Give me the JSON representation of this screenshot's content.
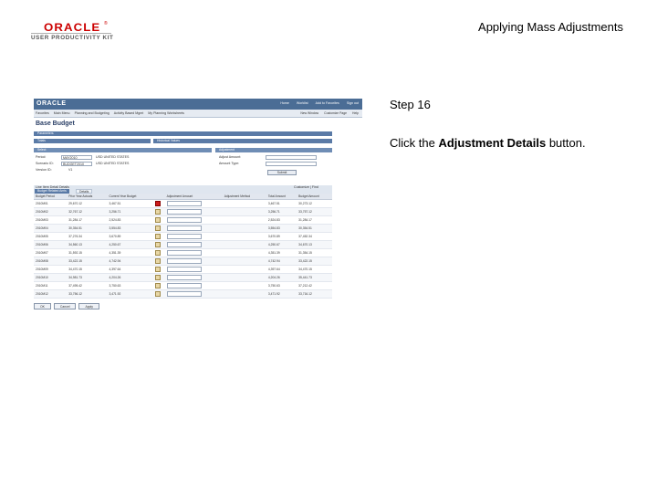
{
  "header": {
    "brand": "ORACLE",
    "brand_reg": "®",
    "product": "USER PRODUCTIVITY KIT",
    "title": "Applying Mass Adjustments"
  },
  "step": {
    "number_label": "Step 16",
    "instruction_prefix": "Click the ",
    "instruction_target": "Adjustment Details",
    "instruction_suffix": " button."
  },
  "screenshot": {
    "brand": "ORACLE",
    "top_links": [
      "Home",
      "Worklist",
      "Add to Favorites",
      "Sign out"
    ],
    "nav_items": [
      "Favorites",
      "Main Menu",
      "Planning and Budgeting",
      "Activity Based Mgmt",
      "My Planning Worksheets"
    ],
    "nav_right": [
      "New Window",
      "Customize Page",
      "Help"
    ],
    "page_title": "Base Budget",
    "sections": [
      "Parameters",
      "Totals",
      "Historical Values",
      "Select",
      "Adjustment"
    ],
    "fields": {
      "period": "Period:",
      "period_value": "MAY2010",
      "scenario": "Scenario ID:",
      "scenario_value": "BUDGET2010",
      "version": "Version ID:",
      "version_value": "V1",
      "period_text": "USD UNITED STATES",
      "scenario_text": "USD UNITED STATES",
      "adjust_amount": "Adjust Amount:",
      "amount_type": "Amount Type:",
      "submit_btn": "Submit"
    },
    "grid": {
      "title": "Line Item Detail Details",
      "customize": "Customize | Find",
      "tabs": [
        "Budget Related Amts",
        "Details"
      ],
      "columns": [
        "Budget Period",
        "Prior Year Actuals",
        "Current Year Budget",
        "Adjust",
        "Adjustment Amount",
        "Adjustment Method",
        "Total Amount",
        "Budget Amount"
      ],
      "rows": [
        {
          "period": "2010M01",
          "prior": "29,670.12",
          "current": "3,467.51",
          "total": "3,467.51",
          "budget": "30,273.12",
          "selected": true
        },
        {
          "period": "2010M02",
          "prior": "32,767.12",
          "current": "3,256.71",
          "total": "3,256.71",
          "budget": "33,757.12",
          "selected": false
        },
        {
          "period": "2010M03",
          "prior": "31,284.17",
          "current": "2,524.83",
          "total": "2,524.83",
          "budget": "31,284.17",
          "selected": false
        },
        {
          "period": "2010M04",
          "prior": "30,354.51",
          "current": "3,554.83",
          "total": "3,554.83",
          "budget": "30,354.51",
          "selected": false
        },
        {
          "period": "2010M05",
          "prior": "37,276.34",
          "current": "3,670.89",
          "total": "3,670.89",
          "budget": "37,452.34",
          "selected": false
        },
        {
          "period": "2010M06",
          "prior": "34,560.13",
          "current": "4,250.67",
          "total": "4,250.67",
          "budget": "34,670.13",
          "selected": false
        },
        {
          "period": "2010M07",
          "prior": "31,592.15",
          "current": "4,351.39",
          "total": "4,351.39",
          "budget": "31,354.15",
          "selected": false
        },
        {
          "period": "2010M08",
          "prior": "33,422.15",
          "current": "4,742.94",
          "total": "4,742.94",
          "budget": "33,422.15",
          "selected": false
        },
        {
          "period": "2010M09",
          "prior": "34,470.15",
          "current": "4,397.64",
          "total": "4,397.64",
          "budget": "34,470.15",
          "selected": false
        },
        {
          "period": "2010M10",
          "prior": "34,981.73",
          "current": "4,204.26",
          "total": "4,204.26",
          "budget": "35,441.73",
          "selected": false
        },
        {
          "period": "2010M11",
          "prior": "37,495.42",
          "current": "3,750.63",
          "total": "3,750.63",
          "budget": "37,212.42",
          "selected": false
        },
        {
          "period": "2010M12",
          "prior": "33,756.12",
          "current": "3,471.92",
          "total": "3,471.92",
          "budget": "33,716.12",
          "selected": false
        }
      ]
    },
    "bottom_buttons": [
      "OK",
      "Cancel",
      "Apply"
    ]
  }
}
